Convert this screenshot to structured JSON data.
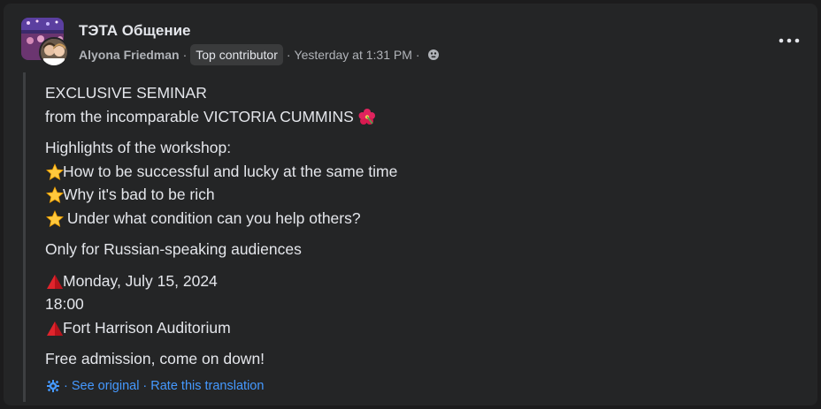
{
  "post": {
    "group_name": "ТЭТА Общение",
    "author": "Alyona Friedman",
    "badge": "Top contributor",
    "timestamp": "Yesterday at 1:31 PM",
    "separator": "·",
    "privacy_icon": "globe-icon",
    "more_icon": "more-options-icon"
  },
  "content": {
    "title": "EXCLUSIVE SEMINAR",
    "subtitle": "from the incomparable VICTORIA CUMMINS",
    "subtitle_emoji": "hibiscus-icon",
    "highlights_heading": "Highlights of the workshop:",
    "highlights": [
      "How to be successful and lucky at the same time",
      "Why it's bad to be rich",
      " Under what condition can you help others?"
    ],
    "highlight_emoji": "star-icon",
    "audience": "Only for Russian-speaking audiences",
    "date": "Monday, July 15, 2024",
    "time": "18:00",
    "venue": "Fort Harrison Auditorium",
    "marker_emoji": "red-triangle-icon",
    "closing": "Free admission, come on down!"
  },
  "footer": {
    "see_original": "See original",
    "rate_translation": "Rate this translation",
    "separator": "·",
    "icon": "gear-icon"
  },
  "colors": {
    "background": "#242526",
    "text": "#e4e6eb",
    "muted": "#b0b3b8",
    "link": "#4599ff",
    "badge_bg": "#3a3b3c"
  }
}
